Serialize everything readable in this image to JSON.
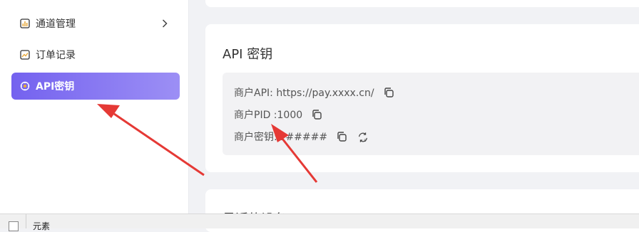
{
  "sidebar": {
    "items": [
      {
        "label": "通道管理",
        "icon": "bar-chart-icon"
      },
      {
        "label": "订单记录",
        "icon": "line-chart-icon"
      },
      {
        "label": "API密钥",
        "icon": "key-gear-icon",
        "active": true
      }
    ]
  },
  "api_card": {
    "title": "API 密钥",
    "rows": [
      {
        "text": "商户API: https://pay.xxxx.cn/"
      },
      {
        "text": "商户PID :1000"
      },
      {
        "text": "商户密钥:######"
      }
    ]
  },
  "next_card": {
    "title": "最近的设备"
  },
  "bottom_bar": {
    "label": "元素"
  },
  "colors": {
    "accent_start": "#7462ef",
    "accent_end": "#9c8ff5",
    "arrow": "#e53935",
    "info_bg": "#f2f2f4"
  }
}
